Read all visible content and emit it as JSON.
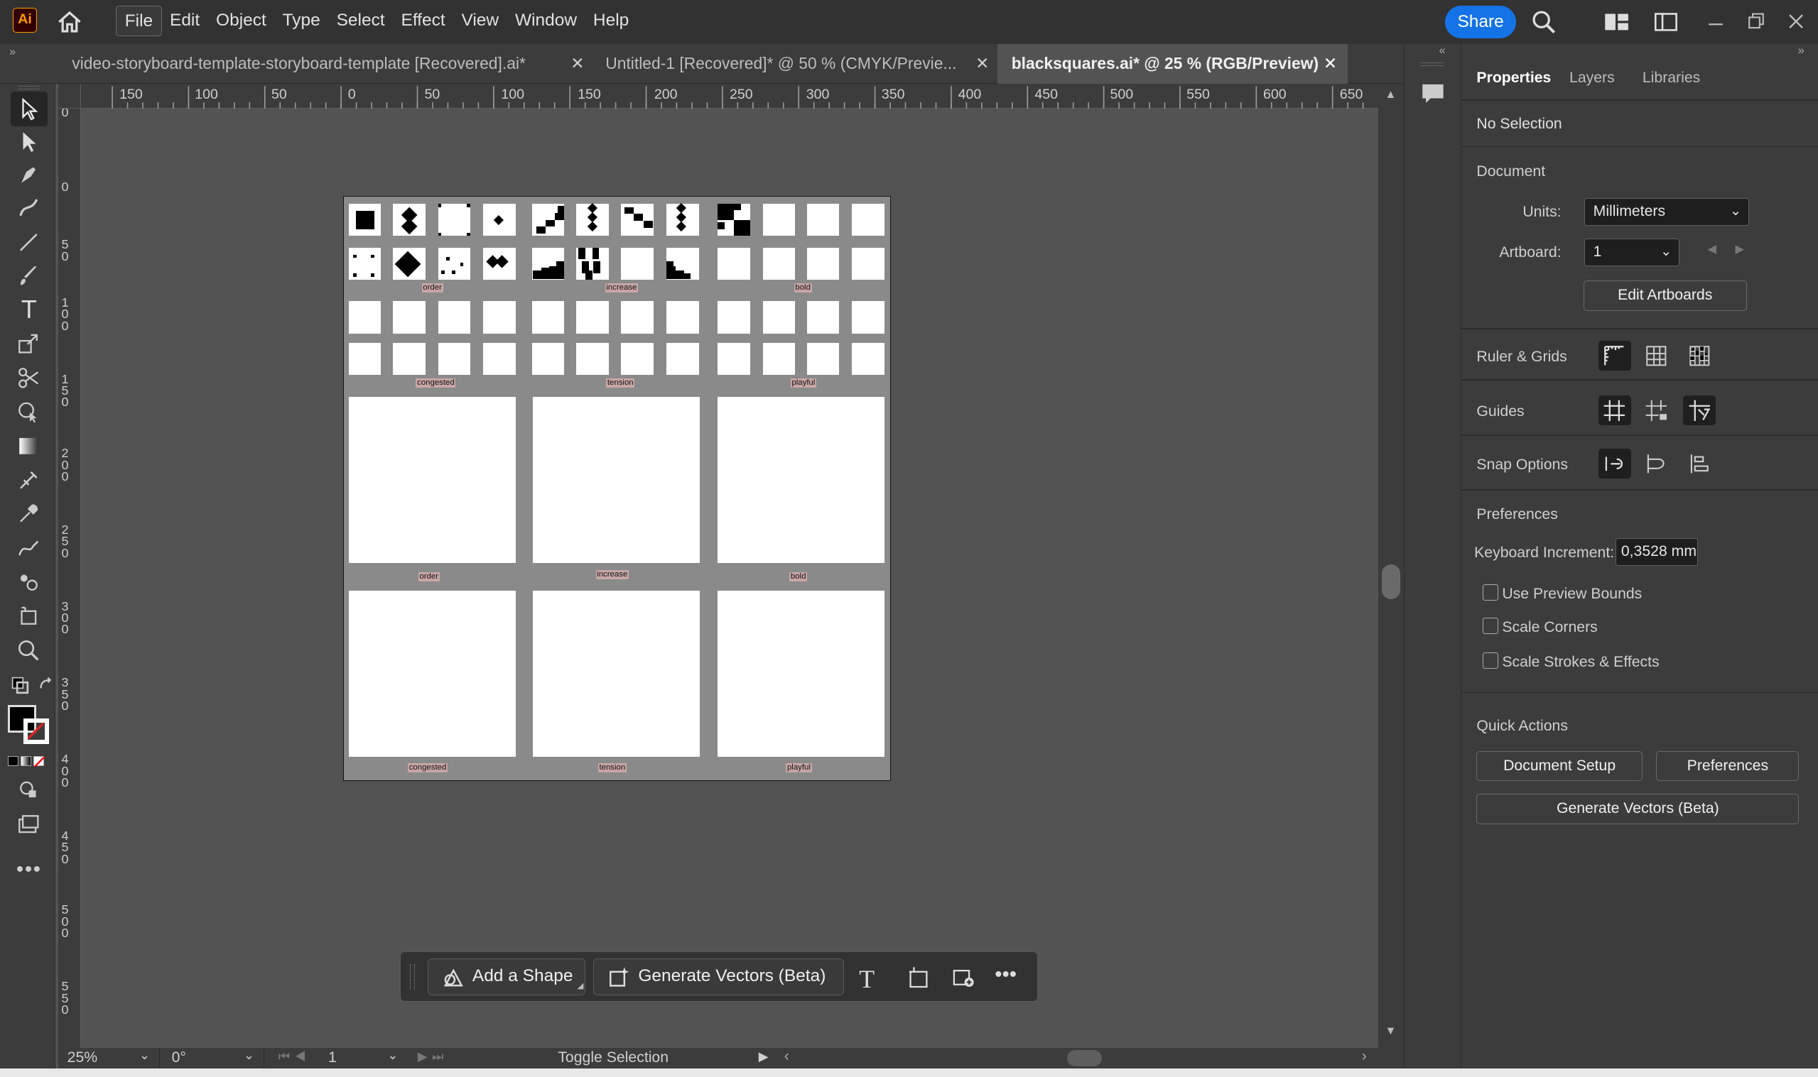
{
  "app": {
    "logo": "Ai"
  },
  "menubar": {
    "items": [
      "File",
      "Edit",
      "Object",
      "Type",
      "Select",
      "Effect",
      "View",
      "Window",
      "Help"
    ],
    "share": "Share"
  },
  "tabs": [
    {
      "label": "video-storyboard-template-storyboard-template [Recovered].ai*"
    },
    {
      "label": "Untitled-1 [Recovered]* @ 50 % (CMYK/Previe..."
    },
    {
      "label": "blacksquares.ai* @ 25 % (RGB/Preview)"
    }
  ],
  "ruler": {
    "h": [
      "150",
      "100",
      "50",
      "0",
      "50",
      "100",
      "150",
      "200",
      "250",
      "300",
      "350",
      "400",
      "450",
      "500",
      "550",
      "600",
      "650"
    ],
    "v": [
      "0",
      "5\n0",
      "1\n0\n0",
      "1\n5\n0",
      "2\n0\n0",
      "2\n5\n0",
      "3\n0\n0",
      "3\n5\n0",
      "4\n0\n0",
      "4\n5\n0",
      "5\n0\n0",
      "5\n5\n0"
    ]
  },
  "artboard": {
    "labels_small_row1": [
      "order",
      "increase",
      "bold"
    ],
    "labels_small_row2": [
      "congested",
      "tension",
      "playful"
    ],
    "labels_big_row1": [
      "order",
      "increase",
      "bold"
    ],
    "labels_big_row2": [
      "congested",
      "tension",
      "playful"
    ]
  },
  "context_bar": {
    "add_shape": "Add a Shape",
    "generate_vectors": "Generate Vectors (Beta)"
  },
  "status": {
    "zoom": "25%",
    "rotation": "0°",
    "artboard": "1",
    "mode": "Toggle Selection"
  },
  "panel": {
    "tabs": [
      "Properties",
      "Layers",
      "Libraries"
    ],
    "no_selection": "No Selection",
    "document": "Document",
    "units_label": "Units:",
    "units_value": "Millimeters",
    "artboard_label": "Artboard:",
    "artboard_value": "1",
    "edit_artboards": "Edit Artboards",
    "ruler_grids": "Ruler & Grids",
    "guides": "Guides",
    "snap_options": "Snap Options",
    "preferences_title": "Preferences",
    "keyboard_increment_label": "Keyboard Increment:",
    "keyboard_increment_value": "0,3528 mm",
    "use_preview_bounds": "Use Preview Bounds",
    "scale_corners": "Scale Corners",
    "scale_strokes": "Scale Strokes & Effects",
    "quick_actions": "Quick Actions",
    "document_setup": "Document Setup",
    "preferences_btn": "Preferences",
    "generate_vectors_btn": "Generate Vectors (Beta)"
  },
  "colors": {
    "accent": "#1473e6",
    "brand": "#ff9a00"
  }
}
